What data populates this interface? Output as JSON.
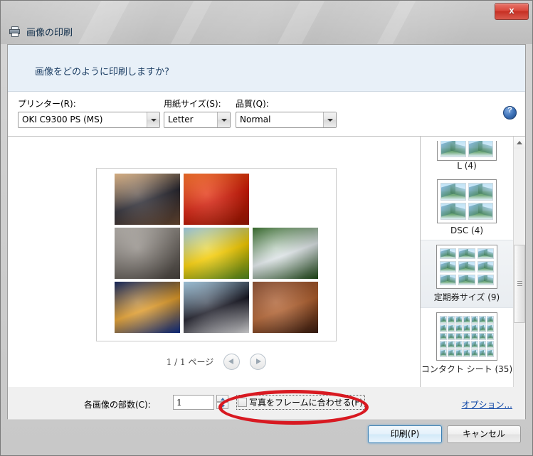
{
  "window": {
    "title": "画像の印刷",
    "title_icon": "printer-icon",
    "close_label": "x"
  },
  "banner": {
    "question": "画像をどのように印刷しますか?"
  },
  "fields": {
    "printer": {
      "label": "プリンター(R):",
      "value": "OKI C9300 PS (MS)"
    },
    "paper_size": {
      "label": "用紙サイズ(S):",
      "value": "Letter"
    },
    "quality": {
      "label": "品質(Q):",
      "value": "Normal"
    },
    "help_icon": "help-icon"
  },
  "preview": {
    "page_label": "1 / 1 ページ",
    "prev_icon": "triangle-left-icon",
    "next_icon": "triangle-right-icon",
    "photos": [
      {
        "name": "lighthouse",
        "c1": "#f0c08a",
        "c2": "#2b2a33",
        "c3": "#6b4a33"
      },
      {
        "name": "red-chrysanthemum",
        "c1": "#ff6a1a",
        "c2": "#d81b07",
        "c3": "#9c1803"
      },
      {
        "name": "empty-slot",
        "c1": "",
        "c2": "",
        "c3": ""
      },
      {
        "name": "koala",
        "c1": "#b9b4ae",
        "c2": "#7d7771",
        "c3": "#49443f"
      },
      {
        "name": "yellow-tulips",
        "c1": "#9fd4f2",
        "c2": "#ffd400",
        "c3": "#4f8a22"
      },
      {
        "name": "hydrangea",
        "c1": "#2f6b23",
        "c2": "#e6edf0",
        "c3": "#1e4a17"
      },
      {
        "name": "jellyfish",
        "c1": "#061a57",
        "c2": "#e9a22c",
        "c3": "#0b2d8c"
      },
      {
        "name": "penguins",
        "c1": "#a9d4ef",
        "c2": "#1a1a26",
        "c3": "#e8e8ea"
      },
      {
        "name": "desert-butte",
        "c1": "#8c4a2a",
        "c2": "#b5622f",
        "c3": "#3a1d12"
      }
    ]
  },
  "layouts": {
    "items": [
      {
        "caption": "L (4)",
        "cols": 2,
        "rows": 2,
        "partial": true,
        "selected": false
      },
      {
        "caption": "DSC (4)",
        "cols": 2,
        "rows": 2,
        "partial": false,
        "selected": false
      },
      {
        "caption": "定期券サイズ (9)",
        "cols": 3,
        "rows": 3,
        "partial": false,
        "selected": true
      },
      {
        "caption": "コンタクト シート (35)",
        "cols": 7,
        "rows": 5,
        "partial": false,
        "selected": false
      }
    ],
    "scroll_up_icon": "triangle-up-icon",
    "scroll_down_icon": "triangle-down-icon"
  },
  "bottom": {
    "copies_label": "各画像の部数(C):",
    "copies_value": "1",
    "spinner_up_icon": "spinner-up-icon",
    "spinner_down_icon": "spinner-down-icon",
    "fit_frame_label": "写真をフレームに合わせる(F)",
    "fit_frame_checked": false,
    "options_link": "オプション..."
  },
  "footer": {
    "print_label": "印刷(P)",
    "cancel_label": "キャンセル"
  },
  "annotation": {
    "shape": "red-ellipse",
    "color": "#d81921"
  }
}
